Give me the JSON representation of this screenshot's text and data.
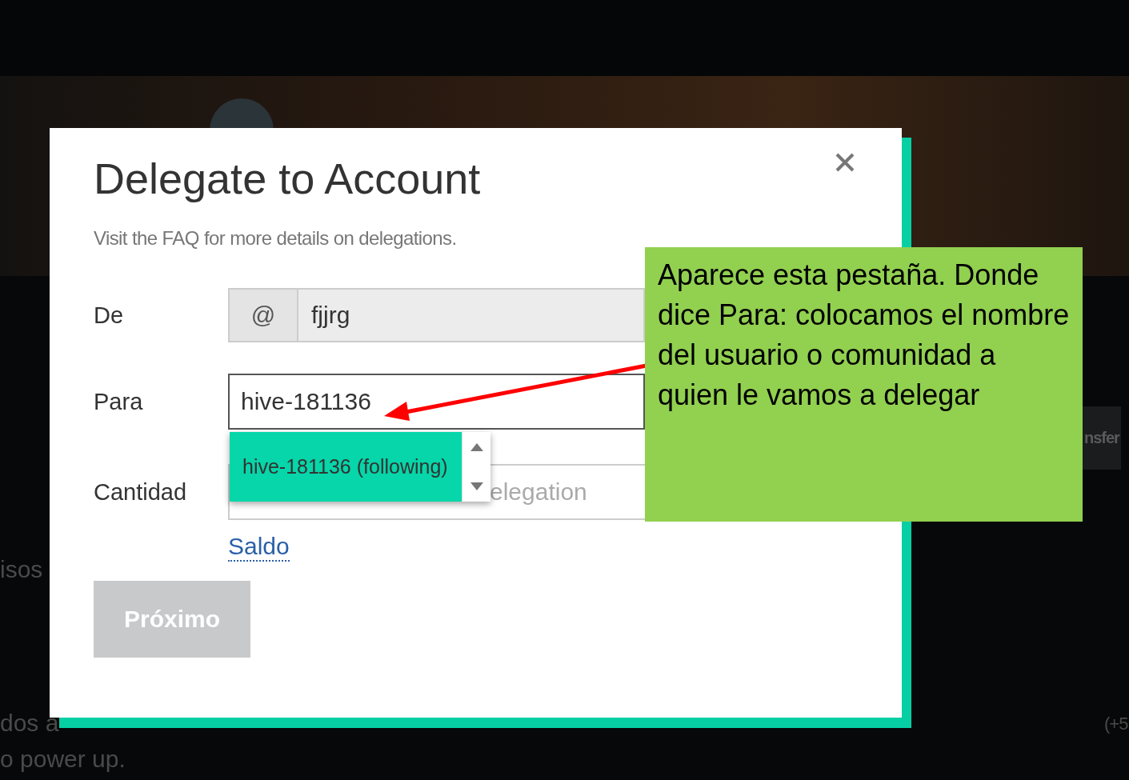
{
  "background": {
    "fragments": [
      {
        "text": "isos",
        "kind": "text"
      },
      {
        "text": "dos a",
        "kind": "text"
      },
      {
        "text": "o power up.",
        "kind": "text"
      },
      {
        "text": "nsfer",
        "kind": "button"
      },
      {
        "text": "(+5",
        "kind": "text"
      }
    ]
  },
  "dialog": {
    "title": "Delegate to Account",
    "subtitle": "Visit the FAQ for more details on delegations.",
    "fields": [
      {
        "label": "De",
        "kind": "prefixed",
        "prefix": "@",
        "value": "fjjrg",
        "disabled": true
      },
      {
        "label": "Para",
        "kind": "text",
        "value": "hive-181136",
        "focused": true,
        "suggestions": [
          {
            "text": "hive-181136 (following)",
            "selected": true
          }
        ]
      },
      {
        "label": "Cantidad",
        "kind": "amount",
        "placeholder": "elegation"
      }
    ],
    "balance_link": "Saldo",
    "submit": {
      "label": "Próximo",
      "disabled": true
    }
  },
  "callout": {
    "text": "Aparece esta pestaña. Donde dice Para: colocamos el nombre del usuario o comunidad a quien le vamos a delegar"
  }
}
